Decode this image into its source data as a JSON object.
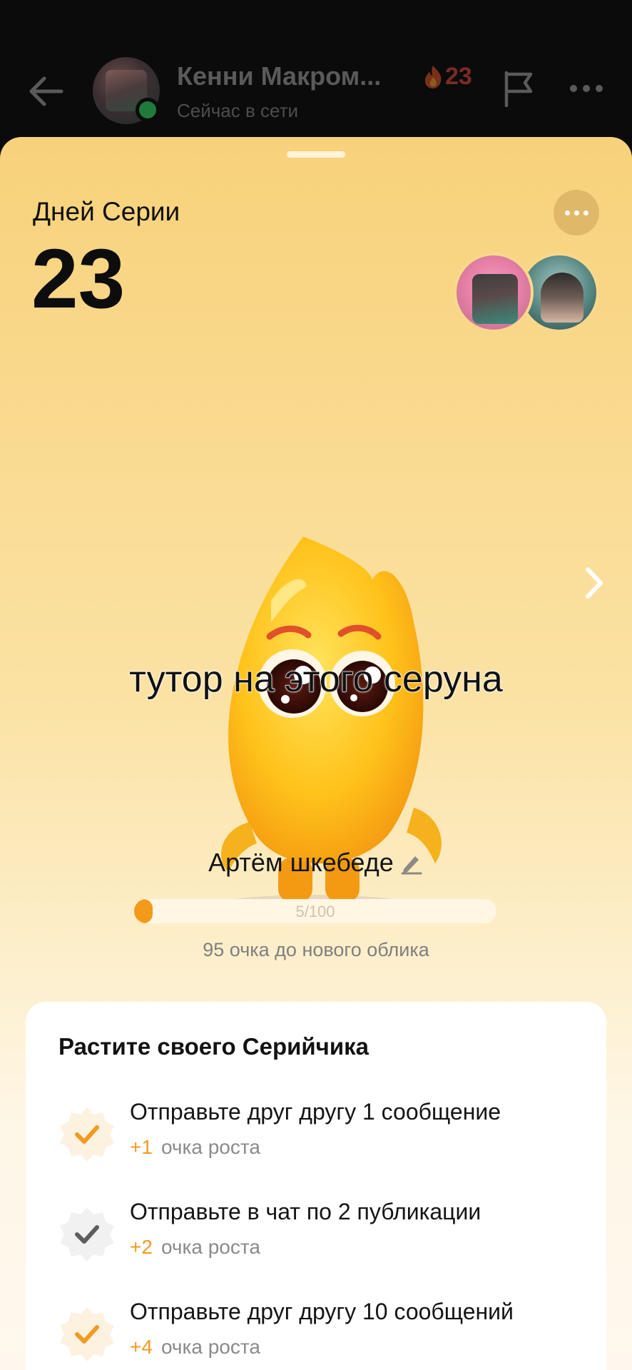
{
  "header": {
    "contact_name": "Кенни Макром...",
    "status": "Сейчас в сети",
    "streak_count": "23"
  },
  "streak": {
    "days_label": "Дней Серии",
    "days_count": "23"
  },
  "caption": "тутор на этого серуна",
  "pet": {
    "name": "Артём шкебеде",
    "progress_text": "5/100",
    "progress_fraction": 0.05,
    "points_note": "95 очка до нового облика"
  },
  "tasks_card": {
    "title": "Растите своего Серийчика",
    "tasks": [
      {
        "title": "Отправьте друг другу 1 сообщение",
        "points": "+1",
        "points_label": "очка роста",
        "status": "done"
      },
      {
        "title": "Отправьте в чат по 2 публикации",
        "points": "+2",
        "points_label": "очка роста",
        "status": "pending"
      },
      {
        "title": "Отправьте друг другу 10 сообщений",
        "points": "+4",
        "points_label": "очка роста",
        "status": "done"
      }
    ]
  },
  "colors": {
    "accent": "#f39a1a",
    "sheet_top": "#f8d27a",
    "sheet_bottom": "#fef8ee"
  },
  "icons": [
    "back-arrow-icon",
    "fire-icon",
    "flag-icon",
    "more-dots-icon",
    "chevron-right-icon",
    "pencil-icon",
    "check-badge-icon"
  ]
}
